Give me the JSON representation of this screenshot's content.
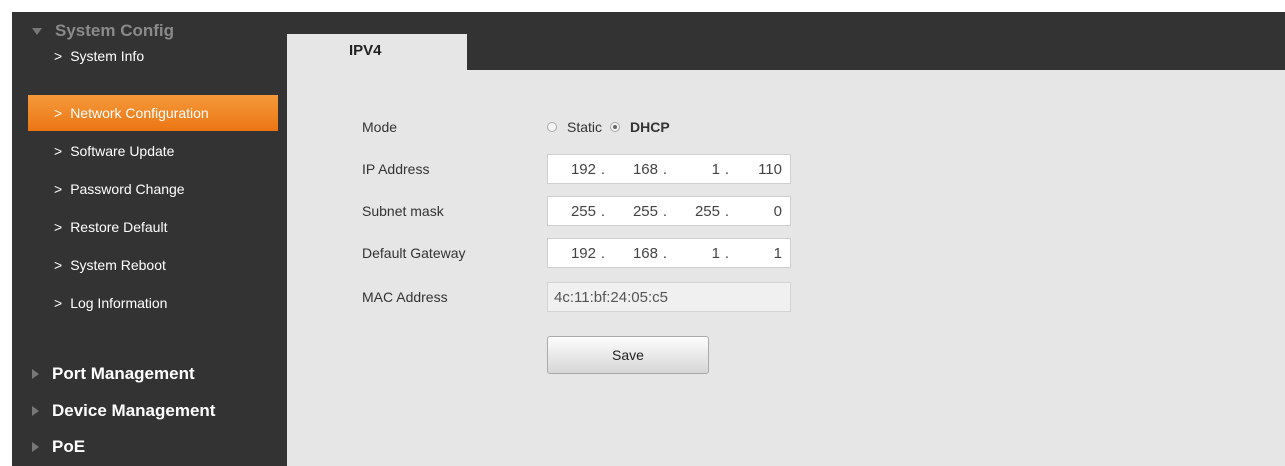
{
  "sidebar": {
    "system_config": "System Config",
    "items": [
      {
        "label": "System Info"
      },
      {
        "label": "Network Configuration"
      },
      {
        "label": "Software Update"
      },
      {
        "label": "Password Change"
      },
      {
        "label": "Restore Default"
      },
      {
        "label": "System Reboot"
      },
      {
        "label": "Log Information"
      }
    ],
    "sections": [
      {
        "label": "Port Management"
      },
      {
        "label": "Device Management"
      },
      {
        "label": "PoE"
      }
    ],
    "chevron": ">",
    "active_index": 1,
    "accent_color": "#f07f1c"
  },
  "tab": {
    "label": "IPV4"
  },
  "form": {
    "mode_label": "Mode",
    "mode_options": [
      "Static",
      "DHCP"
    ],
    "mode_selected": "DHCP",
    "ip_label": "IP Address",
    "ip": [
      "192",
      "168",
      "1",
      "110"
    ],
    "subnet_label": "Subnet mask",
    "subnet": [
      "255",
      "255",
      "255",
      "0"
    ],
    "gateway_label": "Default Gateway",
    "gateway": [
      "192",
      "168",
      "1",
      "1"
    ],
    "mac_label": "MAC Address",
    "mac": "4c:11:bf:24:05:c5",
    "save_label": "Save"
  },
  "dot": "."
}
